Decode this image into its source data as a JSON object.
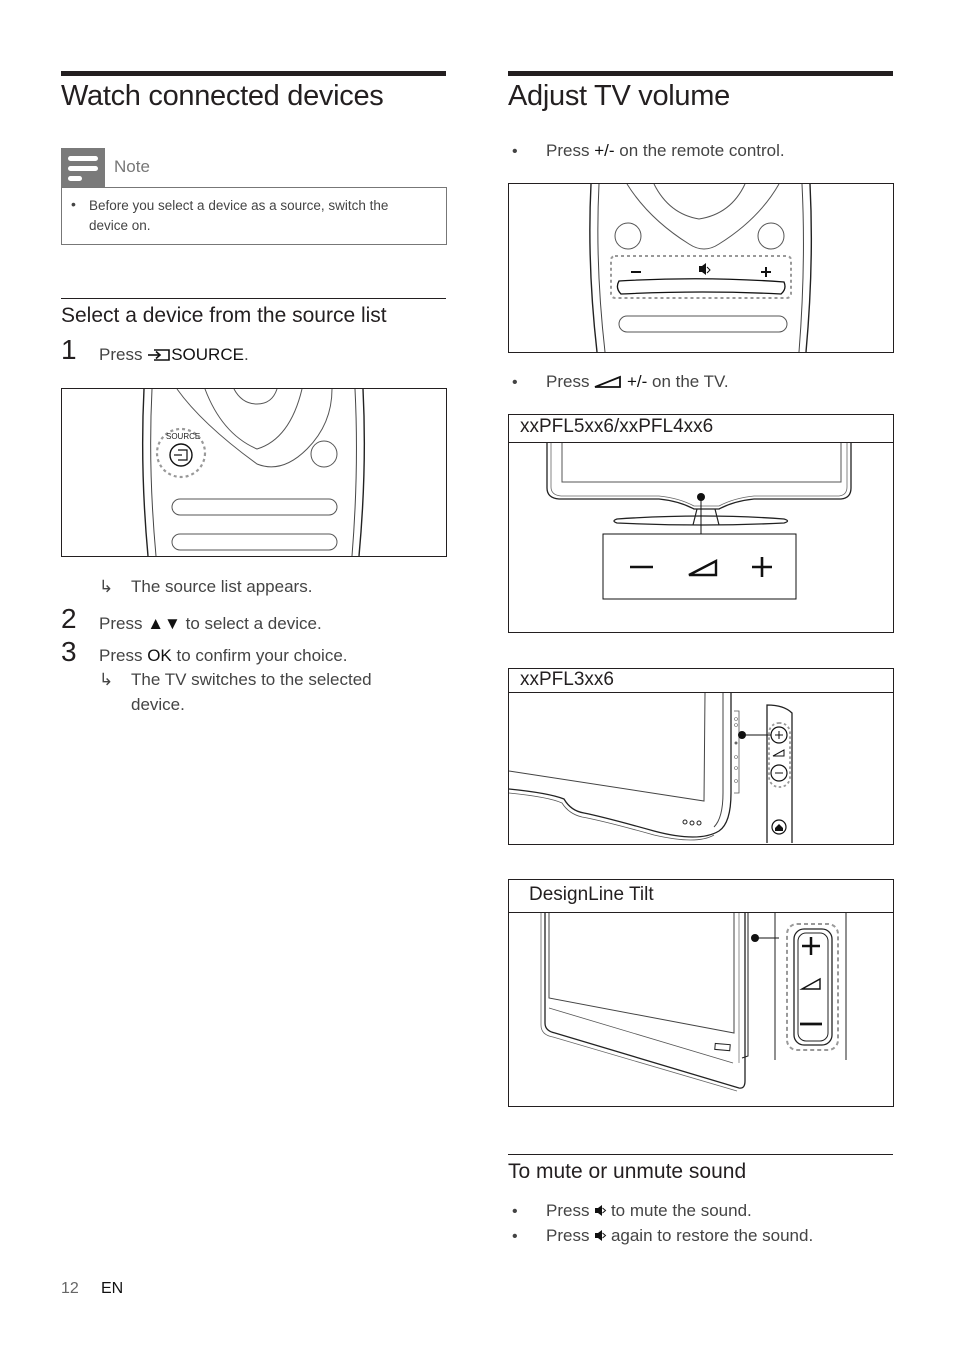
{
  "left_column": {
    "title": "Watch connected devices",
    "note": {
      "label": "Note",
      "icon": "note-icon",
      "items": [
        "Before you select a device as a source, switch the device on."
      ]
    },
    "section": {
      "title": "Select a device from the source list",
      "steps": [
        {
          "num": "1",
          "prefix": "Press",
          "icon": "source-icon",
          "key": "SOURCE",
          "suffix": "."
        },
        {
          "num": "2",
          "prefix": "Press",
          "icon": "up-down-arrows-icon",
          "key": "▲▼",
          "suffix": "to select a device."
        },
        {
          "num": "3",
          "prefix": "Press",
          "key": "OK",
          "suffix": "to confirm your choice."
        }
      ],
      "results": [
        "The source list appears.",
        "The TV switches to the selected",
        "device."
      ],
      "result_arrow": "↳",
      "figure_label": "SOURCE"
    }
  },
  "right_column": {
    "title": "Adjust TV volume",
    "bullets": [
      {
        "prefix": "Press",
        "key": "+/-",
        "suffix": "on the remote control."
      },
      {
        "prefix": "Press",
        "icon": "volume-icon",
        "key": "+/-",
        "suffix": "on the TV."
      }
    ],
    "figures": [
      {
        "title": "xxPFL5xx6/xxPFL4xx6"
      },
      {
        "title": "xxPFL3xx6"
      },
      {
        "title": "DesignLine Tilt"
      }
    ],
    "mute_section": {
      "title": "To mute or unmute sound",
      "items": [
        {
          "prefix": "Press",
          "icon": "mute-icon",
          "suffix": "to mute the sound."
        },
        {
          "prefix": "Press",
          "icon": "mute-icon",
          "suffix": "again to restore the sound."
        }
      ]
    }
  },
  "footer": {
    "page_number": "12",
    "language": "EN"
  }
}
